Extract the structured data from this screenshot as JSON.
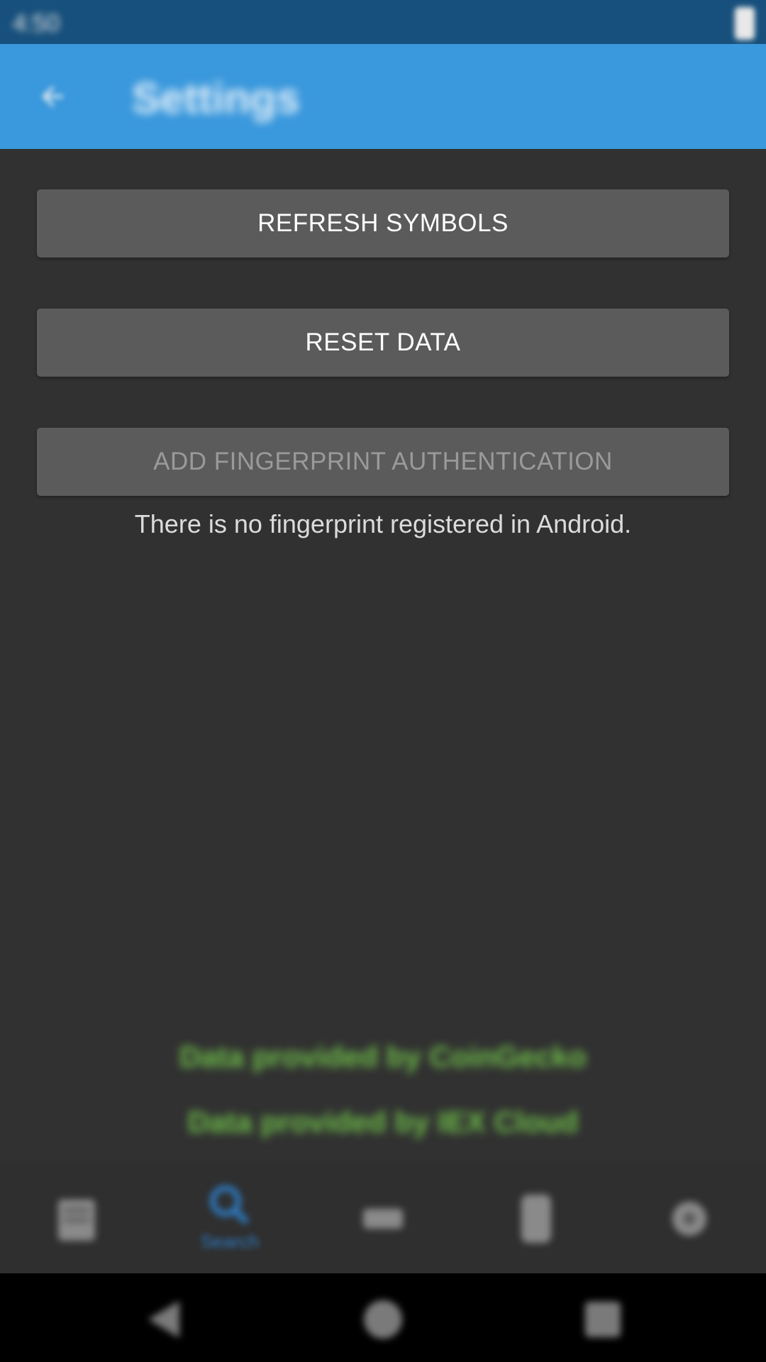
{
  "status_bar": {
    "time": "4:50"
  },
  "app_bar": {
    "title": "Settings"
  },
  "buttons": {
    "refresh_symbols": "REFRESH SYMBOLS",
    "reset_data": "RESET DATA",
    "add_fingerprint": "ADD FINGERPRINT AUTHENTICATION"
  },
  "fingerprint_note": "There is no fingerprint registered in Android.",
  "credits": [
    "Data provided by CoinGecko",
    "Data provided by IEX Cloud"
  ],
  "bottom_nav": {
    "items": [
      {
        "icon": "portfolio-icon",
        "label": ""
      },
      {
        "icon": "search-icon",
        "label": "Search"
      },
      {
        "icon": "compare-icon",
        "label": ""
      },
      {
        "icon": "device-icon",
        "label": ""
      },
      {
        "icon": "settings-icon",
        "label": ""
      }
    ],
    "active_color": "#2e7cc4"
  },
  "colors": {
    "app_bar": "#3a98dc",
    "status_bar": "#17507c",
    "background": "#313131",
    "button": "#5b5b5c",
    "credit": "#6fbf4a"
  }
}
